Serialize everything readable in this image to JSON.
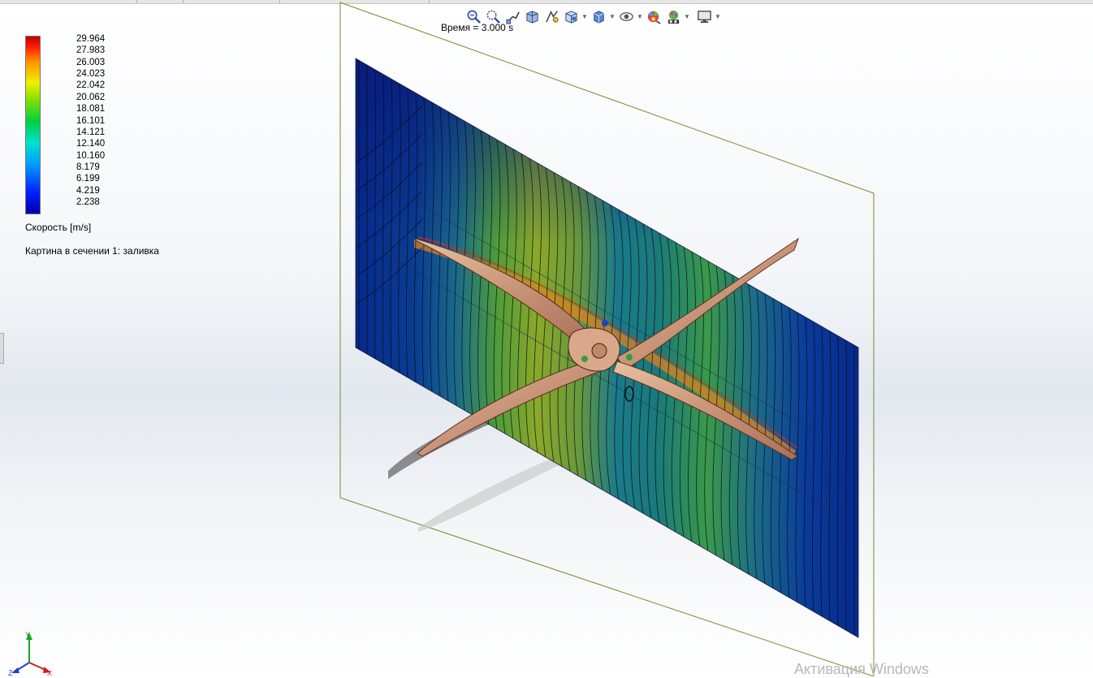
{
  "toolbar": {
    "items": [
      {
        "icon": "zoom-to-fit-icon"
      },
      {
        "icon": "zoom-to-area-icon"
      },
      {
        "icon": "previous-view-icon"
      },
      {
        "icon": "section-view-icon"
      },
      {
        "icon": "dynamic-annotation-icon"
      },
      {
        "icon": "view-orientation-icon",
        "dropdown": true
      },
      {
        "icon": "display-style-icon",
        "dropdown": true
      },
      {
        "icon": "hide-show-items-icon",
        "dropdown": true
      },
      {
        "icon": "edit-appearance-icon"
      },
      {
        "icon": "apply-scene-icon",
        "dropdown": true
      },
      {
        "icon": "view-settings-icon",
        "dropdown": true
      }
    ]
  },
  "simulation": {
    "time_label": "Время = 3.000 s",
    "result_label": "Картина в сечении 1: заливка"
  },
  "legend": {
    "title": "Скорость [m/s]",
    "values": [
      "29.964",
      "27.983",
      "26.003",
      "24.023",
      "22.042",
      "20.062",
      "18.081",
      "16.101",
      "14.121",
      "12.140",
      "10.160",
      "8.179",
      "6.199",
      "4.219",
      "2.238"
    ],
    "colors": {
      "min": "#0000a8",
      "mid": "#00d040",
      "max": "#c00000"
    }
  },
  "triad": {
    "x_label": "X",
    "y_label": "Y",
    "z_label": "Z"
  },
  "watermark": {
    "text": "Активация Windows"
  }
}
